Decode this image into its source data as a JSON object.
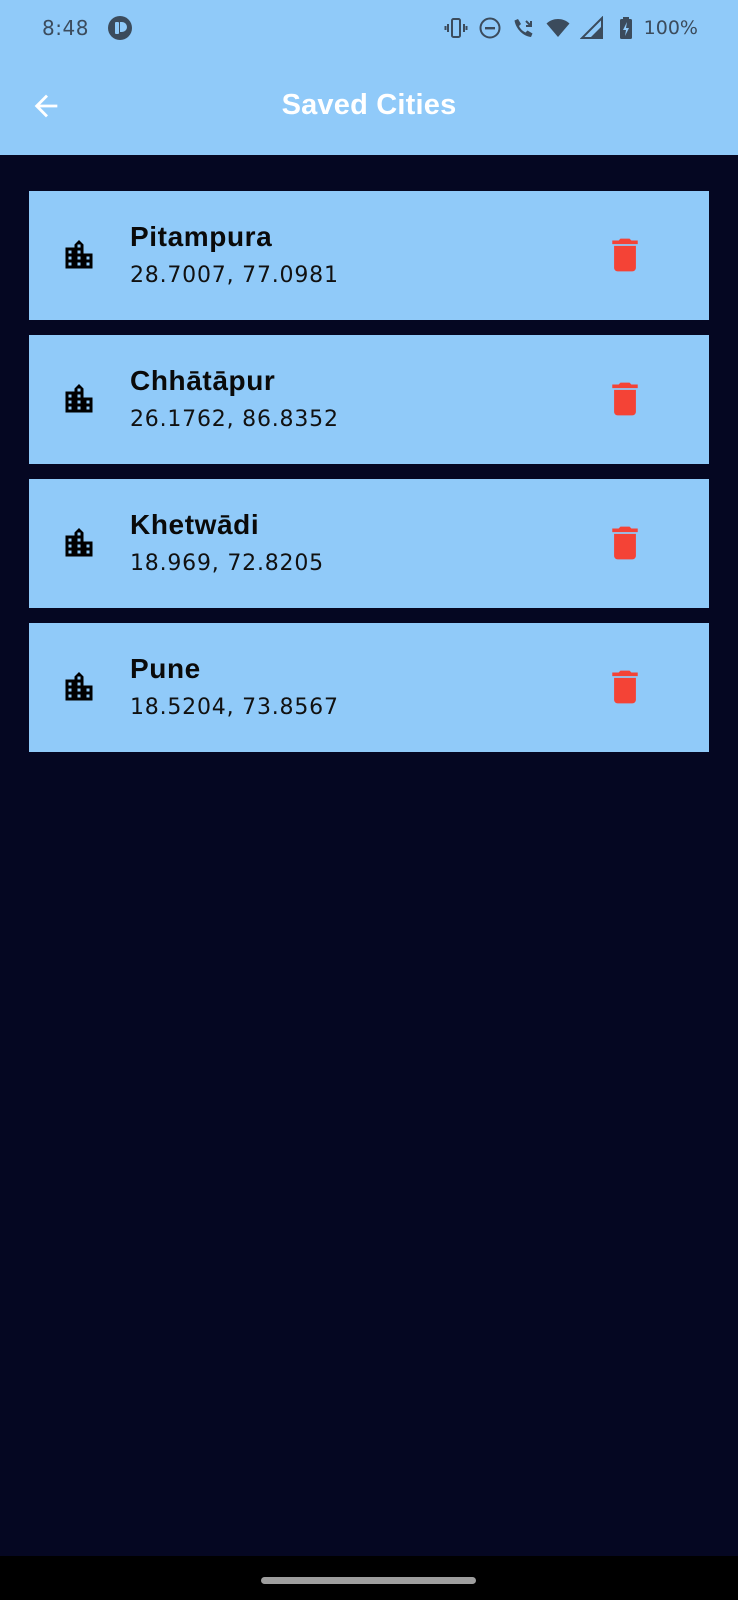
{
  "status_bar": {
    "time": "8:48",
    "battery_text": "100%",
    "icons": [
      "app-indicator-icon",
      "vibrate-icon",
      "do-not-disturb-icon",
      "wifi-calling-icon",
      "wifi-icon",
      "cell-signal-icon",
      "battery-charging-icon"
    ]
  },
  "app_bar": {
    "title": "Saved Cities",
    "back_icon": "arrow-back-icon"
  },
  "cities": [
    {
      "name": "Pitampura",
      "coords": "28.7007, 77.0981"
    },
    {
      "name": "Chhātāpur",
      "coords": "26.1762, 86.8352"
    },
    {
      "name": "Khetwādi",
      "coords": "18.969, 72.8205"
    },
    {
      "name": "Pune",
      "coords": "18.5204, 73.8567"
    }
  ],
  "colors": {
    "app_bar": "#90CAF9",
    "card": "#90CAF9",
    "background": "#050722",
    "delete": "#F44336"
  }
}
